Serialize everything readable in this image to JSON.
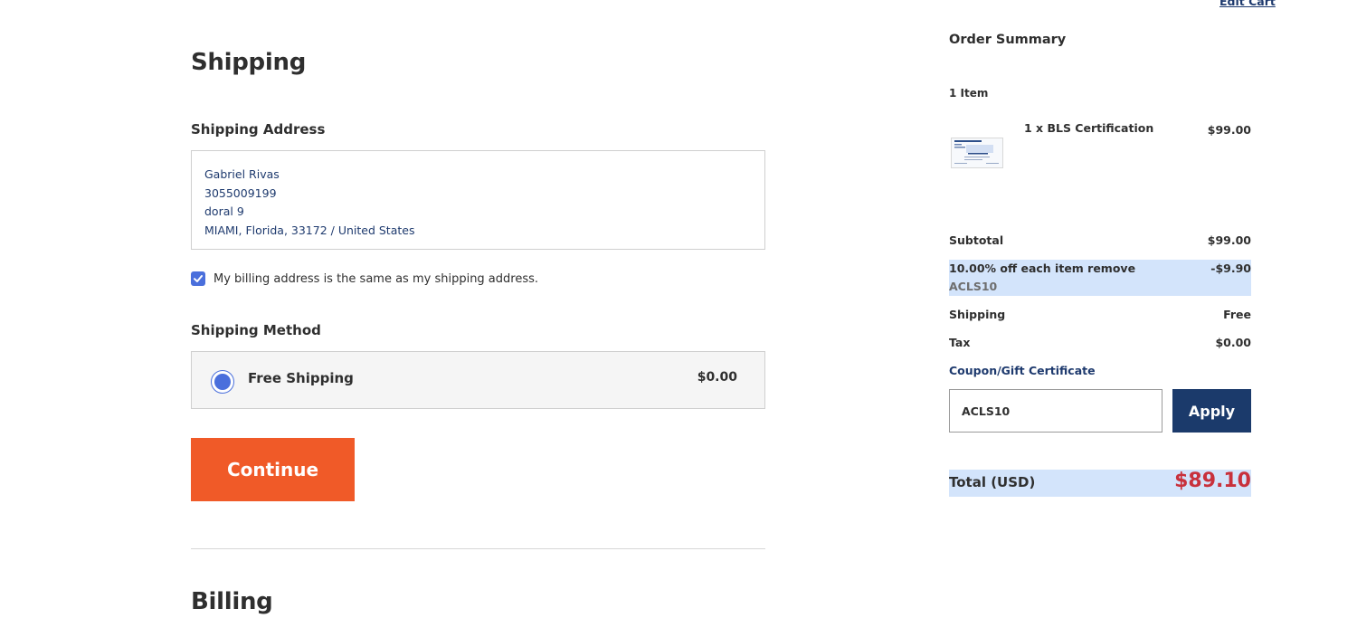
{
  "shipping": {
    "heading": "Shipping",
    "address_label": "Shipping Address",
    "address_lines": [
      "Gabriel Rivas",
      "3055009199",
      "doral 9",
      "MIAMI, Florida, 33172 / United States"
    ],
    "billing_same_text": "My billing address is the same as my shipping address.",
    "billing_same_checked": true,
    "method_label": "Shipping Method",
    "method": {
      "name": "Free Shipping",
      "price": "$0.00",
      "selected": true
    },
    "continue_label": "Continue"
  },
  "billing": {
    "heading": "Billing"
  },
  "summary": {
    "edit_cart_label": "Edit Cart",
    "title": "Order Summary",
    "item_count": "1 Item",
    "items": [
      {
        "name": "1 x BLS Certification",
        "price": "$99.00",
        "thumbnail_icon": "certificate-thumbnail"
      }
    ],
    "subtotal_label": "Subtotal",
    "subtotal_value": "$99.00",
    "discount_label": "10.00% off each item remove",
    "discount_code": "ACLS10",
    "discount_value": "-$9.90",
    "shipping_label": "Shipping",
    "shipping_value": "Free",
    "tax_label": "Tax",
    "tax_value": "$0.00",
    "coupon_label": "Coupon/Gift Certificate",
    "coupon_value": "ACLS10",
    "apply_label": "Apply",
    "total_label": "Total (USD)",
    "total_value": "$89.10"
  },
  "colors": {
    "accent_orange": "#f05a28",
    "navy": "#1b3a6b",
    "link_blue": "#1e3a6e",
    "selection_blue": "#4a6fdc",
    "highlight_bg": "#d3e4fb",
    "total_red": "#c8313c"
  }
}
